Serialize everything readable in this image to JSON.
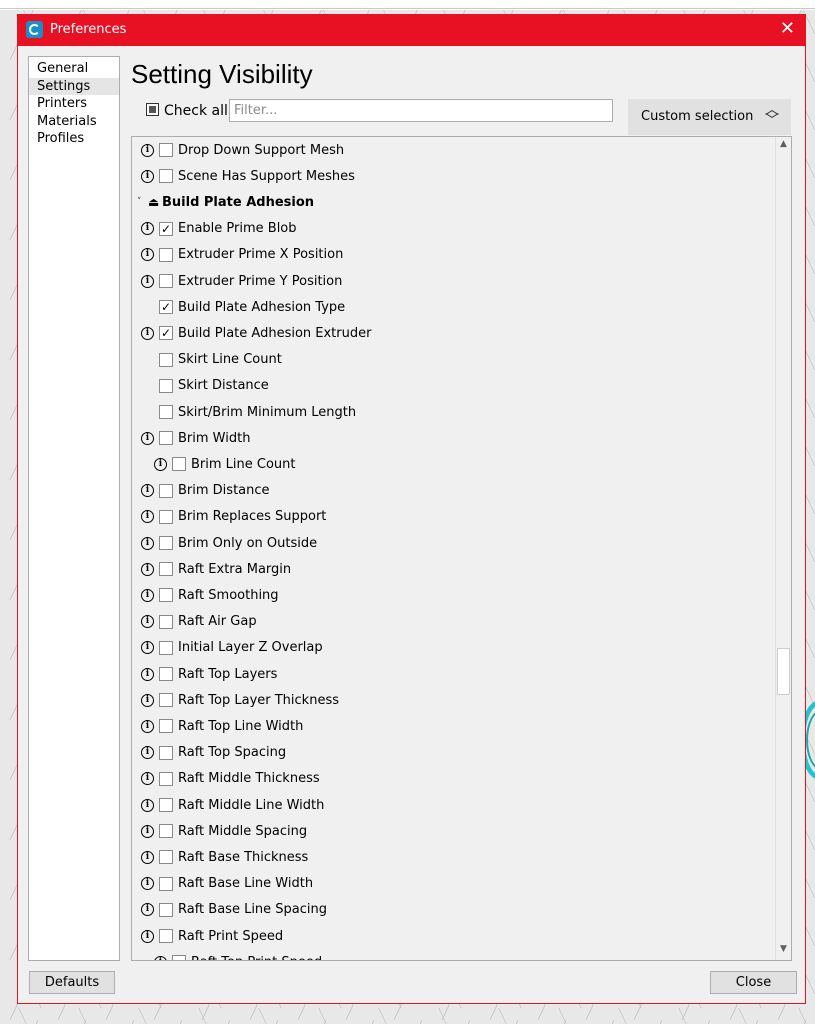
{
  "window": {
    "title": "Preferences",
    "close_glyph": "✕"
  },
  "sidebar": {
    "items": [
      {
        "label": "General",
        "selected": false
      },
      {
        "label": "Settings",
        "selected": true
      },
      {
        "label": "Printers",
        "selected": false
      },
      {
        "label": "Materials",
        "selected": false
      },
      {
        "label": "Profiles",
        "selected": false
      }
    ]
  },
  "page": {
    "heading": "Setting Visibility",
    "check_all_label": "Check all",
    "filter_placeholder": "Filter...",
    "filter_value": "",
    "visibility_preset": "Custom selection"
  },
  "settings_list": [
    {
      "label": "Drop Down Support Mesh",
      "checked": false,
      "info": true,
      "indent": 0
    },
    {
      "label": "Scene Has Support Meshes",
      "checked": false,
      "info": true,
      "indent": 0
    },
    {
      "category": true,
      "label": "Build Plate Adhesion",
      "icon": "build-plate-icon"
    },
    {
      "label": "Enable Prime Blob",
      "checked": true,
      "info": true,
      "indent": 0
    },
    {
      "label": "Extruder Prime X Position",
      "checked": false,
      "info": true,
      "indent": 0
    },
    {
      "label": "Extruder Prime Y Position",
      "checked": false,
      "info": true,
      "indent": 0
    },
    {
      "label": "Build Plate Adhesion Type",
      "checked": true,
      "info": false,
      "indent": 0
    },
    {
      "label": "Build Plate Adhesion Extruder",
      "checked": true,
      "info": true,
      "indent": 0
    },
    {
      "label": "Skirt Line Count",
      "checked": false,
      "info": false,
      "indent": 0
    },
    {
      "label": "Skirt Distance",
      "checked": false,
      "info": false,
      "indent": 0
    },
    {
      "label": "Skirt/Brim Minimum Length",
      "checked": false,
      "info": false,
      "indent": 0
    },
    {
      "label": "Brim Width",
      "checked": false,
      "info": true,
      "indent": 0
    },
    {
      "label": "Brim Line Count",
      "checked": false,
      "info": true,
      "indent": 1
    },
    {
      "label": "Brim Distance",
      "checked": false,
      "info": true,
      "indent": 0
    },
    {
      "label": "Brim Replaces Support",
      "checked": false,
      "info": true,
      "indent": 0
    },
    {
      "label": "Brim Only on Outside",
      "checked": false,
      "info": true,
      "indent": 0
    },
    {
      "label": "Raft Extra Margin",
      "checked": false,
      "info": true,
      "indent": 0
    },
    {
      "label": "Raft Smoothing",
      "checked": false,
      "info": true,
      "indent": 0
    },
    {
      "label": "Raft Air Gap",
      "checked": false,
      "info": true,
      "indent": 0
    },
    {
      "label": "Initial Layer Z Overlap",
      "checked": false,
      "info": true,
      "indent": 0
    },
    {
      "label": "Raft Top Layers",
      "checked": false,
      "info": true,
      "indent": 0
    },
    {
      "label": "Raft Top Layer Thickness",
      "checked": false,
      "info": true,
      "indent": 0
    },
    {
      "label": "Raft Top Line Width",
      "checked": false,
      "info": true,
      "indent": 0
    },
    {
      "label": "Raft Top Spacing",
      "checked": false,
      "info": true,
      "indent": 0
    },
    {
      "label": "Raft Middle Thickness",
      "checked": false,
      "info": true,
      "indent": 0
    },
    {
      "label": "Raft Middle Line Width",
      "checked": false,
      "info": true,
      "indent": 0
    },
    {
      "label": "Raft Middle Spacing",
      "checked": false,
      "info": true,
      "indent": 0
    },
    {
      "label": "Raft Base Thickness",
      "checked": false,
      "info": true,
      "indent": 0
    },
    {
      "label": "Raft Base Line Width",
      "checked": false,
      "info": true,
      "indent": 0
    },
    {
      "label": "Raft Base Line Spacing",
      "checked": false,
      "info": true,
      "indent": 0
    },
    {
      "label": "Raft Print Speed",
      "checked": false,
      "info": true,
      "indent": 0
    },
    {
      "label": "Raft Top Print Speed",
      "checked": false,
      "info": true,
      "indent": 1
    }
  ],
  "buttons": {
    "defaults": "Defaults",
    "close": "Close"
  },
  "glyphs": {
    "check": "✓",
    "info": "i",
    "caret": "˅",
    "scroll_up": "▲",
    "scroll_down": "▼",
    "chev_up": "︿",
    "chev_down": "﹀"
  }
}
